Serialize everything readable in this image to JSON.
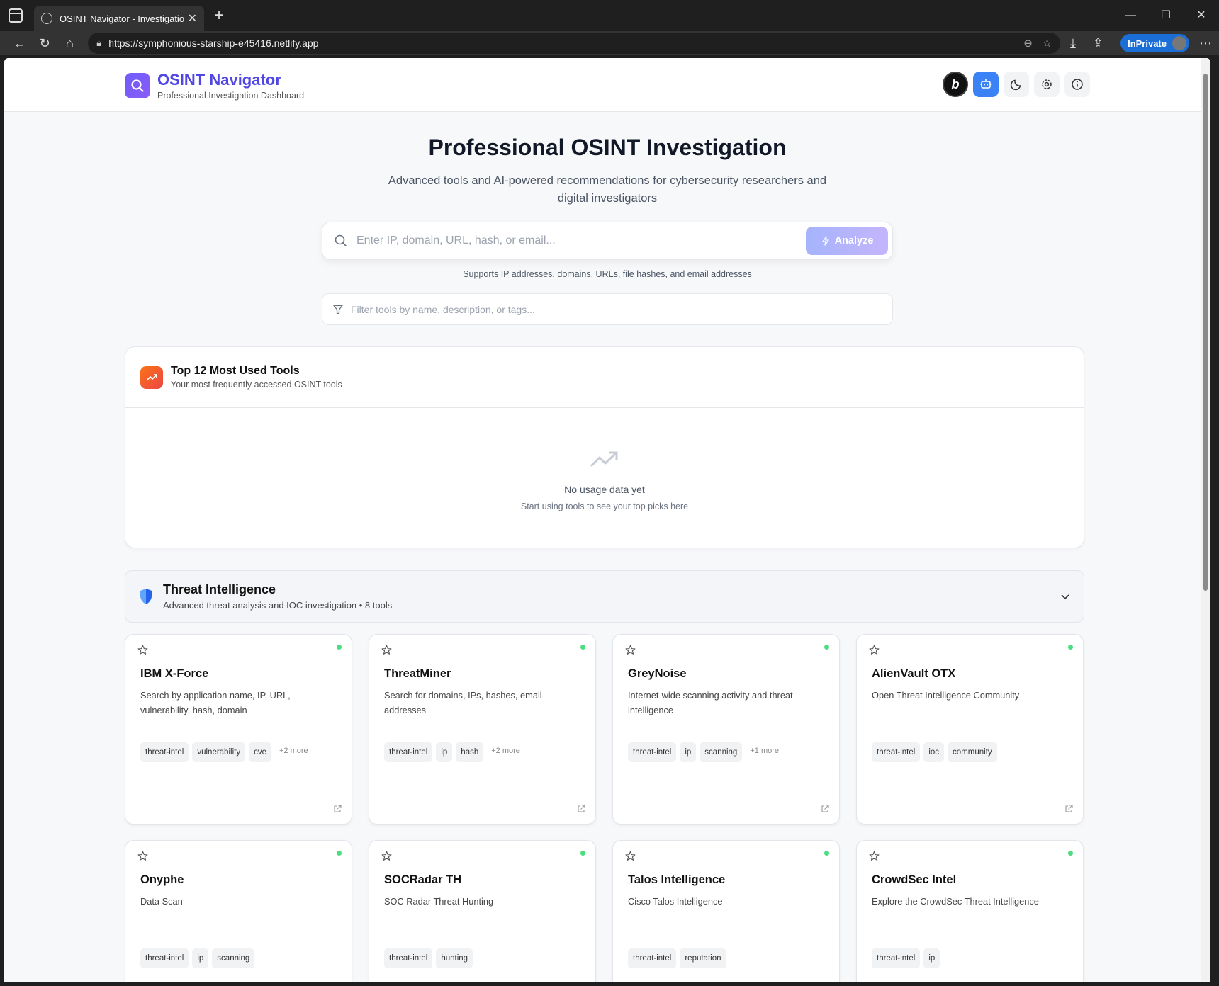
{
  "browser": {
    "tab_title": "OSINT Navigator - Investigation D",
    "url": "https://symphonious-starship-e45416.netlify.app",
    "inprivate_label": "InPrivate"
  },
  "header": {
    "title": "OSINT Navigator",
    "subtitle": "Professional Investigation Dashboard",
    "bing_label": "b"
  },
  "hero": {
    "title": "Professional OSINT Investigation",
    "subtitle": "Advanced tools and AI-powered recommendations for cybersecurity researchers and digital investigators",
    "search_placeholder": "Enter IP, domain, URL, hash, or email...",
    "analyze_label": "Analyze",
    "hint": "Supports IP addresses, domains, URLs, file hashes, and email addresses",
    "filter_placeholder": "Filter tools by name, description, or tags..."
  },
  "top_tools": {
    "title": "Top 12 Most Used Tools",
    "subtitle": "Your most frequently accessed OSINT tools",
    "empty_title": "No usage data yet",
    "empty_subtitle": "Start using tools to see your top picks here"
  },
  "category": {
    "title": "Threat Intelligence",
    "subtitle": "Advanced threat analysis and IOC investigation • 8 tools"
  },
  "tools": [
    {
      "name": "IBM X-Force",
      "desc": "Search by application name, IP, URL, vulnerability, hash, domain",
      "tags": [
        "threat-intel",
        "vulnerability",
        "cve"
      ],
      "more": "+2 more"
    },
    {
      "name": "ThreatMiner",
      "desc": "Search for domains, IPs, hashes, email addresses",
      "tags": [
        "threat-intel",
        "ip",
        "hash"
      ],
      "more": "+2 more"
    },
    {
      "name": "GreyNoise",
      "desc": "Internet-wide scanning activity and threat intelligence",
      "tags": [
        "threat-intel",
        "ip",
        "scanning"
      ],
      "more": "+1 more"
    },
    {
      "name": "AlienVault OTX",
      "desc": "Open Threat Intelligence Community",
      "tags": [
        "threat-intel",
        "ioc",
        "community"
      ],
      "more": ""
    },
    {
      "name": "Onyphe",
      "desc": "Data Scan",
      "tags": [
        "threat-intel",
        "ip",
        "scanning"
      ],
      "more": ""
    },
    {
      "name": "SOCRadar TH",
      "desc": "SOC Radar Threat Hunting",
      "tags": [
        "threat-intel",
        "hunting"
      ],
      "more": ""
    },
    {
      "name": "Talos Intelligence",
      "desc": "Cisco Talos Intelligence",
      "tags": [
        "threat-intel",
        "reputation"
      ],
      "more": ""
    },
    {
      "name": "CrowdSec Intel",
      "desc": "Explore the CrowdSec Threat Intelligence",
      "tags": [
        "threat-intel",
        "ip"
      ],
      "more": ""
    }
  ],
  "colors": {
    "accent": "#4f46e5",
    "status_online": "#4ade80",
    "robot_button": "#3b82f6"
  }
}
